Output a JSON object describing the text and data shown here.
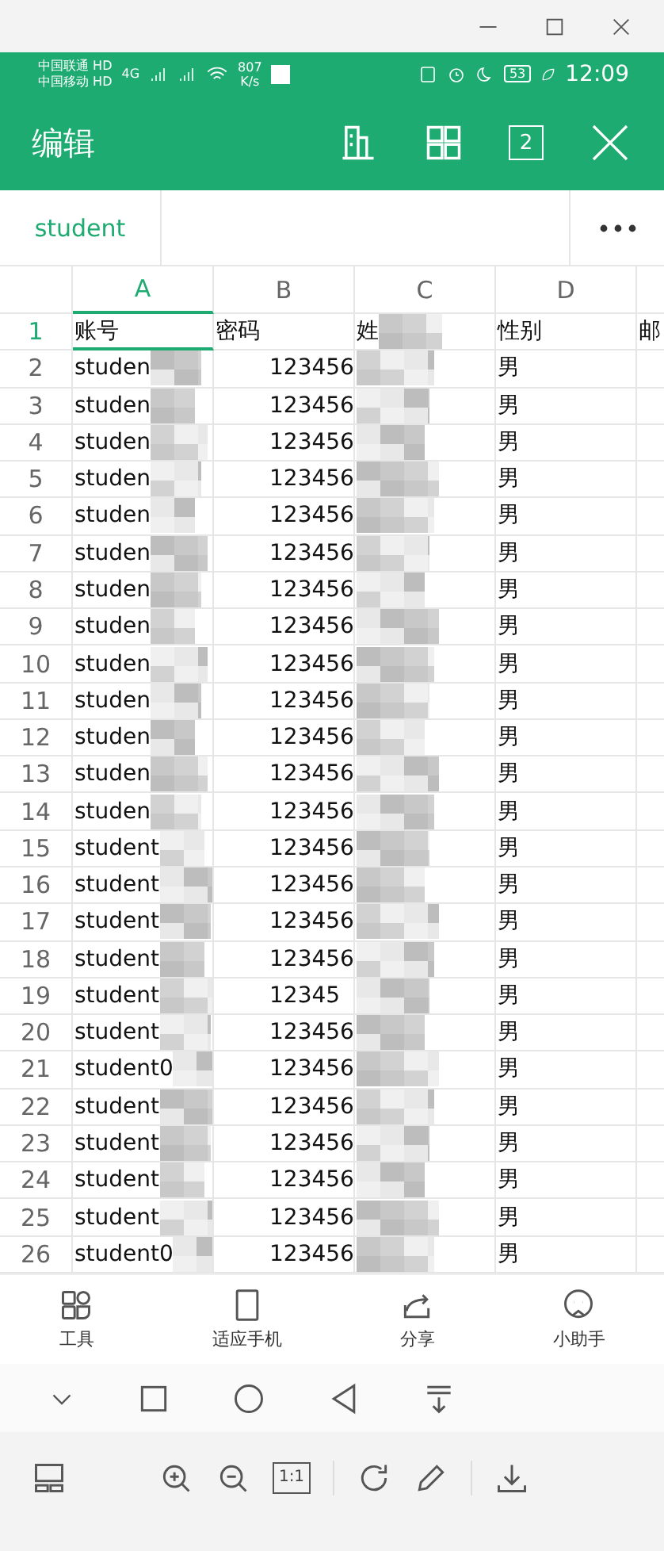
{
  "status_bar": {
    "carriers": [
      {
        "name": "中国联通",
        "badge": "HD"
      },
      {
        "name": "中国移动",
        "badge": "HD"
      }
    ],
    "network": "4G",
    "speed": [
      "807",
      "K/s"
    ],
    "battery": "53",
    "time": "12:09"
  },
  "app_bar": {
    "title": "编辑",
    "page_count": "2"
  },
  "sheet_tabs": [
    {
      "label": "student",
      "selected": true
    }
  ],
  "columns": [
    {
      "label": "A",
      "selected": true
    },
    {
      "label": "B",
      "selected": false
    },
    {
      "label": "C",
      "selected": false
    },
    {
      "label": "D",
      "selected": false
    }
  ],
  "rows": [
    {
      "number": "1",
      "selected": true,
      "cells": [
        "账号",
        "密码",
        "姓",
        "性别",
        "邮"
      ]
    },
    {
      "number": "2",
      "selected": false,
      "cells": [
        "studen",
        "123456",
        "",
        "男"
      ]
    },
    {
      "number": "3",
      "selected": false,
      "cells": [
        "studen",
        "123456",
        "",
        "男"
      ]
    },
    {
      "number": "4",
      "selected": false,
      "cells": [
        "studen",
        "123456",
        "",
        "男"
      ]
    },
    {
      "number": "5",
      "selected": false,
      "cells": [
        "studen",
        "123456",
        "",
        "男"
      ]
    },
    {
      "number": "6",
      "selected": false,
      "cells": [
        "studen",
        "123456",
        "",
        "男"
      ]
    },
    {
      "number": "7",
      "selected": false,
      "cells": [
        "studen",
        "123456",
        "",
        "男"
      ]
    },
    {
      "number": "8",
      "selected": false,
      "cells": [
        "studen",
        "123456",
        "",
        "男"
      ]
    },
    {
      "number": "9",
      "selected": false,
      "cells": [
        "studen",
        "123456",
        "",
        "男"
      ]
    },
    {
      "number": "10",
      "selected": false,
      "cells": [
        "studen",
        "123456",
        "",
        "男"
      ]
    },
    {
      "number": "11",
      "selected": false,
      "cells": [
        "studen",
        "123456",
        "",
        "男"
      ]
    },
    {
      "number": "12",
      "selected": false,
      "cells": [
        "studen",
        "123456",
        "",
        "男"
      ]
    },
    {
      "number": "13",
      "selected": false,
      "cells": [
        "studen",
        "123456",
        "",
        "男"
      ]
    },
    {
      "number": "14",
      "selected": false,
      "cells": [
        "studen",
        "123456",
        "",
        "男"
      ]
    },
    {
      "number": "15",
      "selected": false,
      "cells": [
        "student",
        "123456",
        "",
        "男"
      ]
    },
    {
      "number": "16",
      "selected": false,
      "cells": [
        "student",
        "123456",
        "",
        "男"
      ]
    },
    {
      "number": "17",
      "selected": false,
      "cells": [
        "student",
        "123456",
        "",
        "男"
      ]
    },
    {
      "number": "18",
      "selected": false,
      "cells": [
        "student",
        "123456",
        "",
        "男"
      ]
    },
    {
      "number": "19",
      "selected": false,
      "cells": [
        "student",
        "12345",
        "",
        "男"
      ]
    },
    {
      "number": "20",
      "selected": false,
      "cells": [
        "student",
        "123456",
        "",
        "男"
      ]
    },
    {
      "number": "21",
      "selected": false,
      "cells": [
        "student0",
        "123456",
        "",
        "男"
      ]
    },
    {
      "number": "22",
      "selected": false,
      "cells": [
        "student",
        "123456",
        "",
        "男"
      ]
    },
    {
      "number": "23",
      "selected": false,
      "cells": [
        "student",
        "123456",
        "",
        "男"
      ]
    },
    {
      "number": "24",
      "selected": false,
      "cells": [
        "student",
        "123456",
        "",
        "男"
      ]
    },
    {
      "number": "25",
      "selected": false,
      "cells": [
        "student",
        "123456",
        "",
        "男"
      ]
    },
    {
      "number": "26",
      "selected": false,
      "cells": [
        "student0",
        "123456",
        "",
        "男"
      ]
    }
  ],
  "toolbar": [
    {
      "label": "工具",
      "kind": "tools"
    },
    {
      "label": "适应手机",
      "kind": "fit"
    },
    {
      "label": "分享",
      "kind": "share"
    },
    {
      "label": "小助手",
      "kind": "assistant"
    }
  ],
  "viewer_bar": {
    "actual_size": "1:1"
  }
}
